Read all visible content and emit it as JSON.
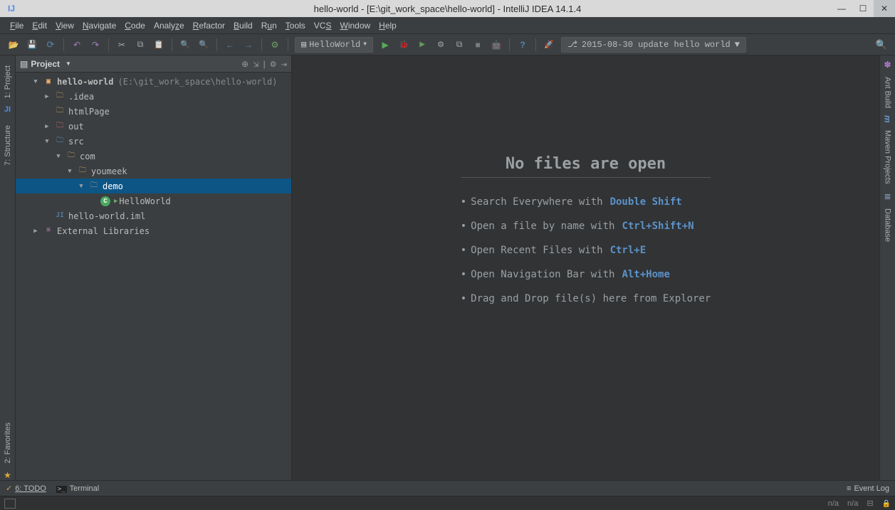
{
  "title": "hello-world - [E:\\git_work_space\\hello-world] - IntelliJ IDEA 14.1.4",
  "menu": [
    "File",
    "Edit",
    "View",
    "Navigate",
    "Code",
    "Analyze",
    "Refactor",
    "Build",
    "Run",
    "Tools",
    "VCS",
    "Window",
    "Help"
  ],
  "toolbar": {
    "run_config": "HelloWorld",
    "vcs_msg": "2015-08-30 update hello world"
  },
  "left_tabs": {
    "project": "1: Project",
    "structure": "7: Structure",
    "favorites": "2: Favorites"
  },
  "right_tabs": {
    "ant": "Ant Build",
    "maven_glyph": "m",
    "maven": "Maven Projects",
    "database": "Database"
  },
  "project": {
    "header_label": "Project",
    "root": {
      "name": "hello-world",
      "hint": "(E:\\git_work_space\\hello-world)"
    },
    "idea": ".idea",
    "htmlPage": "htmlPage",
    "out": "out",
    "src": "src",
    "com": "com",
    "youmeek": "youmeek",
    "demo": "demo",
    "helloWorld": "HelloWorld",
    "iml": "hello-world.iml",
    "ext": "External Libraries"
  },
  "empty": {
    "title": "No files are open",
    "tips": [
      {
        "t": "Search Everywhere with",
        "sc": "Double Shift"
      },
      {
        "t": "Open a file by name with",
        "sc": "Ctrl+Shift+N"
      },
      {
        "t": "Open Recent Files with",
        "sc": "Ctrl+E"
      },
      {
        "t": "Open Navigation Bar with",
        "sc": "Alt+Home"
      },
      {
        "t": "Drag and Drop file(s) here from Explorer",
        "sc": ""
      }
    ]
  },
  "bottom": {
    "todo": "6: TODO",
    "terminal": "Terminal",
    "eventlog": "Event Log"
  },
  "status": {
    "pos": "n/a",
    "enc": "n/a"
  }
}
